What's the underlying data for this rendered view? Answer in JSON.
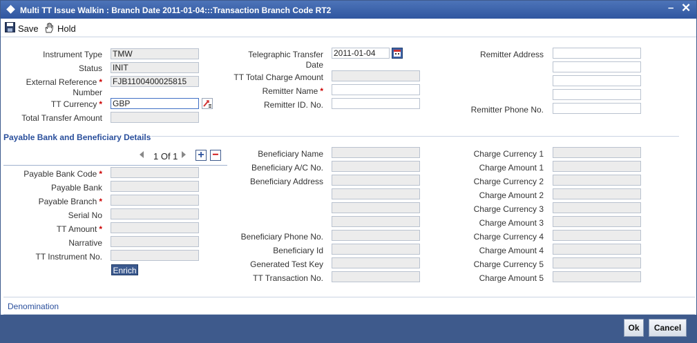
{
  "window": {
    "title": "Multi TT Issue Walkin : Branch Date 2011-01-04:::Transaction Branch Code RT2",
    "minimize_icon": "minimize-icon",
    "close_icon": "close-icon"
  },
  "toolbar": {
    "save_label": "Save",
    "hold_label": "Hold"
  },
  "header": {
    "instrument_type": {
      "label": "Instrument Type",
      "value": "TMW"
    },
    "status": {
      "label": "Status",
      "value": "INIT"
    },
    "ext_ref": {
      "label_line1": "External Reference",
      "label_line2": "Number",
      "value": "FJB1100400025815"
    },
    "tt_currency": {
      "label": "TT Currency",
      "value": "GBP"
    },
    "total_transfer": {
      "label": "Total Transfer Amount",
      "value": ""
    },
    "tt_date": {
      "label_line1": "Telegraphic Transfer",
      "label_line2": "Date",
      "value": "2011-01-04"
    },
    "tt_total_charge": {
      "label": "TT Total Charge Amount",
      "value": ""
    },
    "remitter_name": {
      "label": "Remitter Name",
      "value": ""
    },
    "remitter_id": {
      "label": "Remitter ID. No.",
      "value": ""
    },
    "remitter_address": {
      "label": "Remitter Address",
      "lines": [
        "",
        "",
        "",
        ""
      ]
    },
    "remitter_phone": {
      "label": "Remitter Phone No.",
      "value": ""
    }
  },
  "section": {
    "title": "Payable Bank and Beneficiary Details"
  },
  "pagination": {
    "text": "1 Of 1",
    "add": "+",
    "remove": "−"
  },
  "payable": {
    "bank_code": "Payable Bank Code",
    "bank": "Payable Bank",
    "branch": "Payable Branch",
    "serial": "Serial No",
    "tt_amount": "TT Amount",
    "narrative": "Narrative",
    "instrument_no": "TT Instrument No.",
    "enrich": "Enrich"
  },
  "beneficiary": {
    "name": "Beneficiary Name",
    "account": "Beneficiary A/C No.",
    "address": "Beneficiary Address",
    "phone": "Beneficiary Phone No.",
    "id": "Beneficiary Id",
    "test_key": "Generated Test Key",
    "txn_no": "TT Transaction No."
  },
  "charges": {
    "c1": "Charge Currency 1",
    "a1": "Charge Amount 1",
    "c2": "Charge Currency 2",
    "a2": "Charge Amount 2",
    "c3": "Charge Currency 3",
    "a3": "Charge Amount 3",
    "c4": "Charge Currency 4",
    "a4": "Charge Amount 4",
    "c5": "Charge Currency 5",
    "a5": "Charge Amount 5"
  },
  "denomination": "Denomination",
  "footer": {
    "ok": "Ok",
    "cancel": "Cancel"
  },
  "colors": {
    "title_bar": "#2f56a0",
    "footer": "#3e5a8c",
    "required": "#cc0000",
    "section": "#2a4f9c"
  }
}
